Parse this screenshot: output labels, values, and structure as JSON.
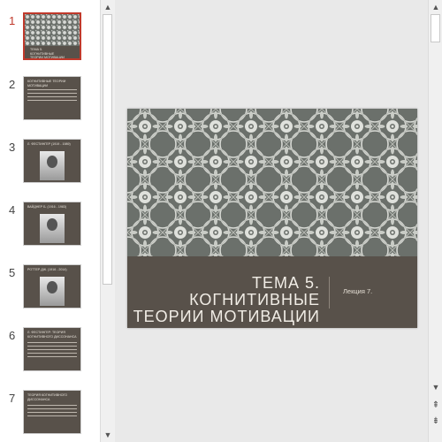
{
  "thumbnails": [
    {
      "num": "1",
      "type": "title",
      "title": "ТЕМА 5. КОГНИТИВНЫЕ ТЕОРИИ МОТИВАЦИИ",
      "selected": true
    },
    {
      "num": "2",
      "type": "text",
      "title": "КОГНИТИВНЫЕ ТЕОРИИ МОТИВАЦИИ"
    },
    {
      "num": "3",
      "type": "photo",
      "title": "Л. ФЕСТИНГЕР (1919 - 1989)"
    },
    {
      "num": "4",
      "type": "photo",
      "title": "ВАЙДНЕР Б. (1916 - 1983)"
    },
    {
      "num": "5",
      "type": "photo",
      "title": "РОТТЕР ДЖ. (1916 - 2014)"
    },
    {
      "num": "6",
      "type": "text",
      "title": "Л. ФЕСТИНГЕР: ТЕОРИЯ КОГНИТИВНОГО ДИССОНАНСА"
    },
    {
      "num": "7",
      "type": "text",
      "title": "ТЕОРИЯ КОГНИТИВНОГО ДИССОНАНСА"
    }
  ],
  "slide": {
    "title_line1": "ТЕМА 5. КОГНИТИВНЫЕ",
    "title_line2": "ТЕОРИИ МОТИВАЦИИ",
    "subtitle": "Лекция 7."
  },
  "colors": {
    "accent": "#c0392b",
    "slide_band": "#58514a",
    "pattern_bg": "#6b706b"
  },
  "icons": {
    "scroll_up": "triangle-up",
    "scroll_down": "triangle-down",
    "prev_slide": "double-chevron-up",
    "next_slide": "double-chevron-down"
  }
}
